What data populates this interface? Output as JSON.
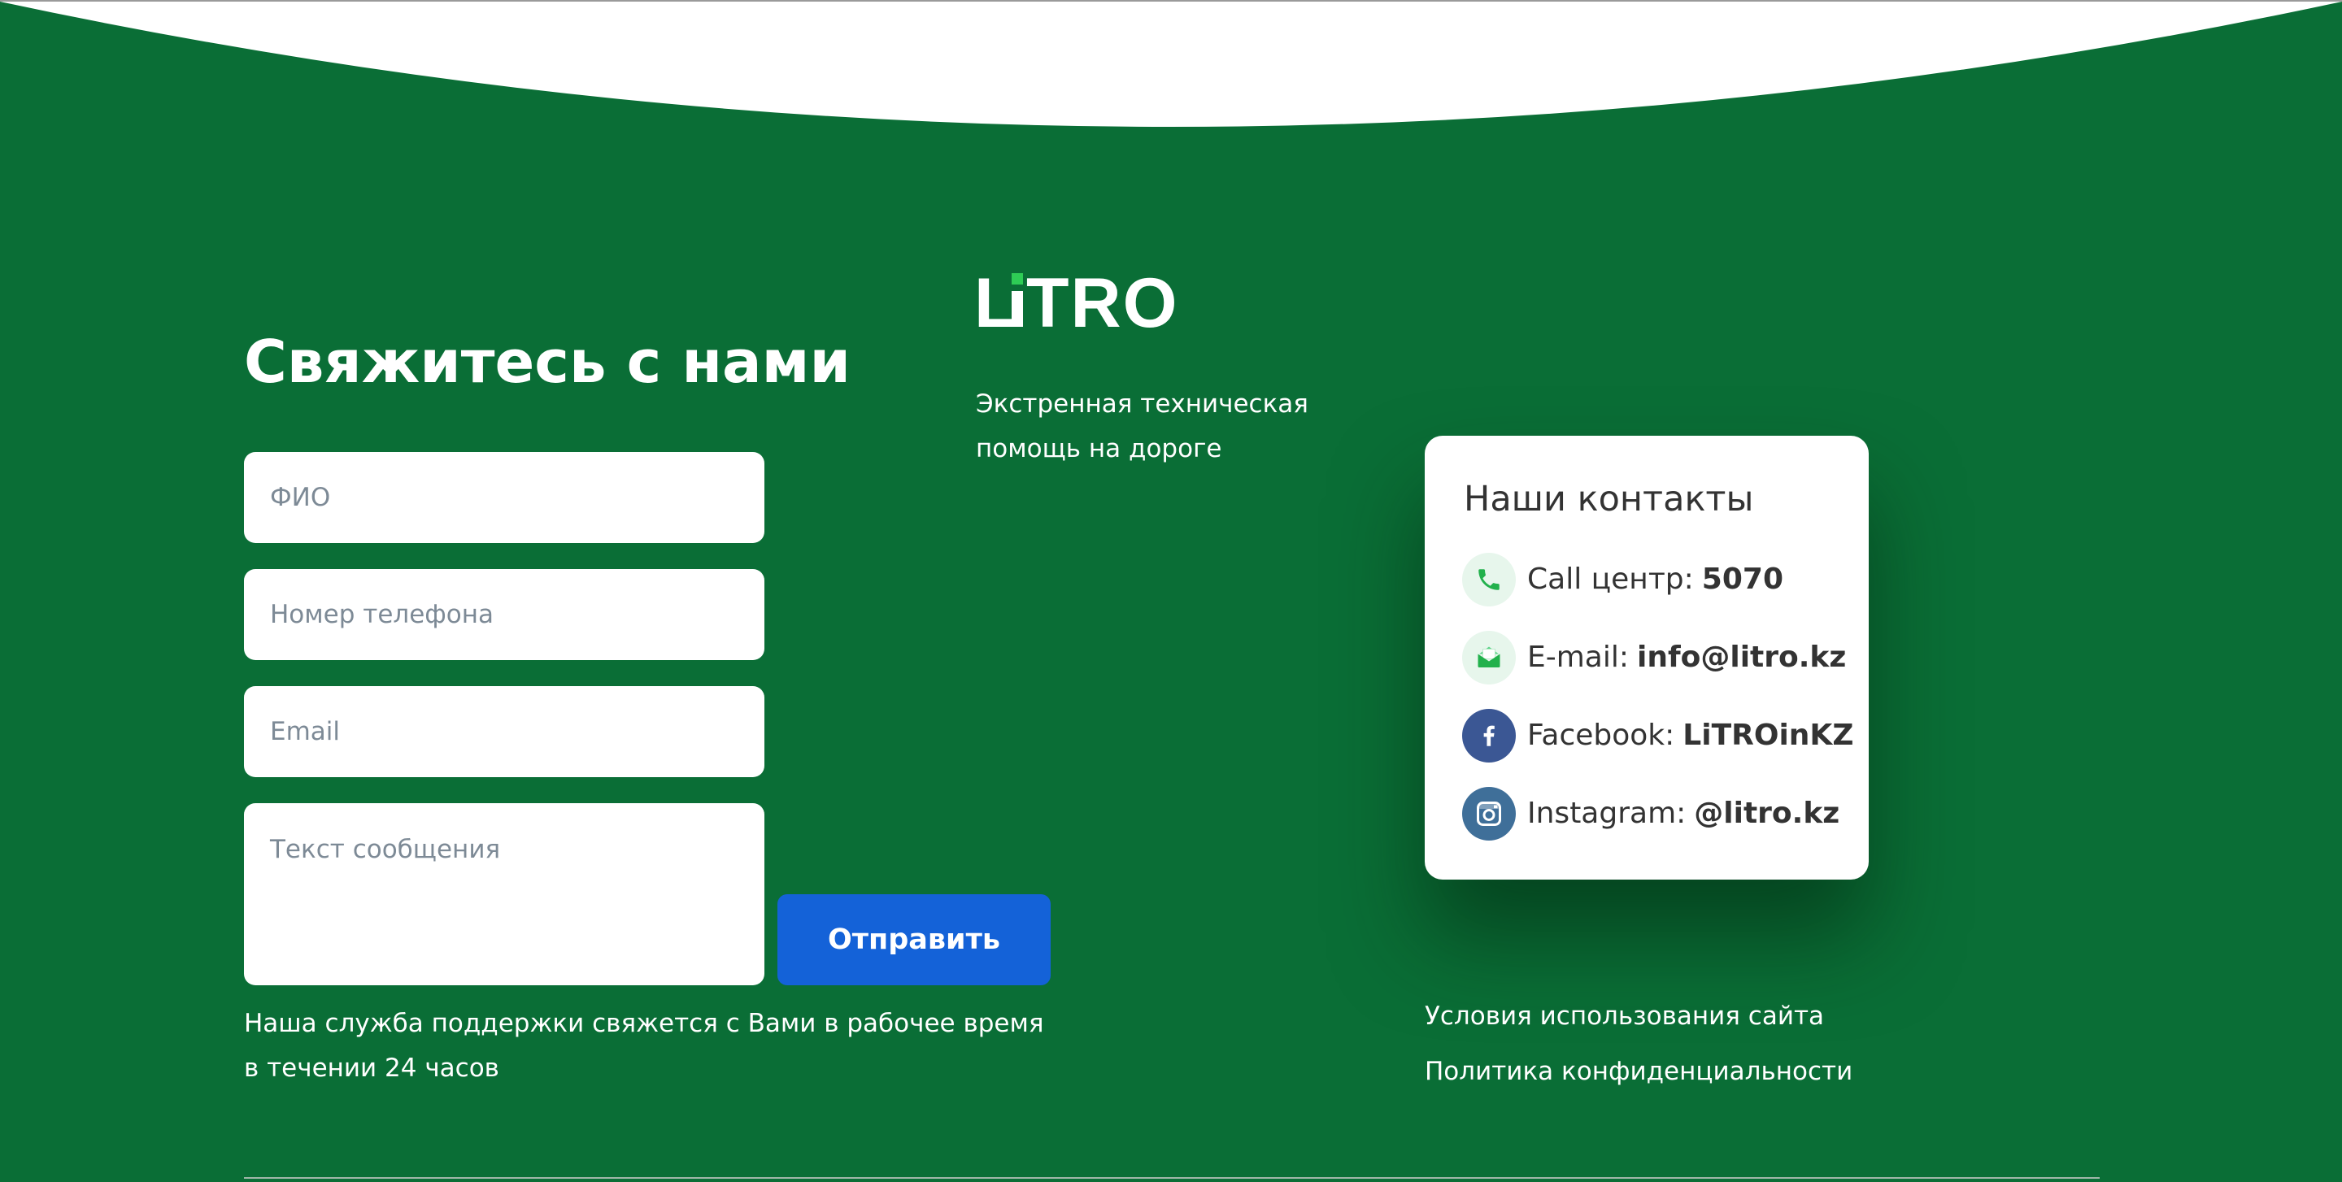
{
  "colors": {
    "background": "#0a6e36",
    "button": "#1462d8",
    "logo_accent": "#2ecc55",
    "card": "#ffffff",
    "text_dark": "#333333"
  },
  "contact_form": {
    "title": "Свяжитесь с нами",
    "fields": {
      "name_placeholder": "ФИО",
      "phone_placeholder": "Номер телефона",
      "email_placeholder": "Email",
      "message_placeholder": "Текст сообщения"
    },
    "submit_label": "Отправить",
    "support_note_line1": "Наша служба поддержки свяжется с Вами в рабочее время",
    "support_note_line2": "в течении 24 часов"
  },
  "brand": {
    "logo_text": "LiTRO",
    "tagline_line1": "Экстренная техническая",
    "tagline_line2": "помощь на дороге"
  },
  "contacts_card": {
    "title": "Наши контакты",
    "items": [
      {
        "icon": "phone-icon",
        "label": "Call центр:",
        "value": "5070"
      },
      {
        "icon": "email-icon",
        "label": "E-mail:",
        "value": "info@litro.kz"
      },
      {
        "icon": "facebook-icon",
        "label": "Facebook:",
        "value": "LiTROinKZ"
      },
      {
        "icon": "instagram-icon",
        "label": "Instagram:",
        "value": "@litro.kz"
      }
    ]
  },
  "legal_links": {
    "terms": "Условия использования сайта",
    "privacy": "Политика конфиденциальности"
  }
}
